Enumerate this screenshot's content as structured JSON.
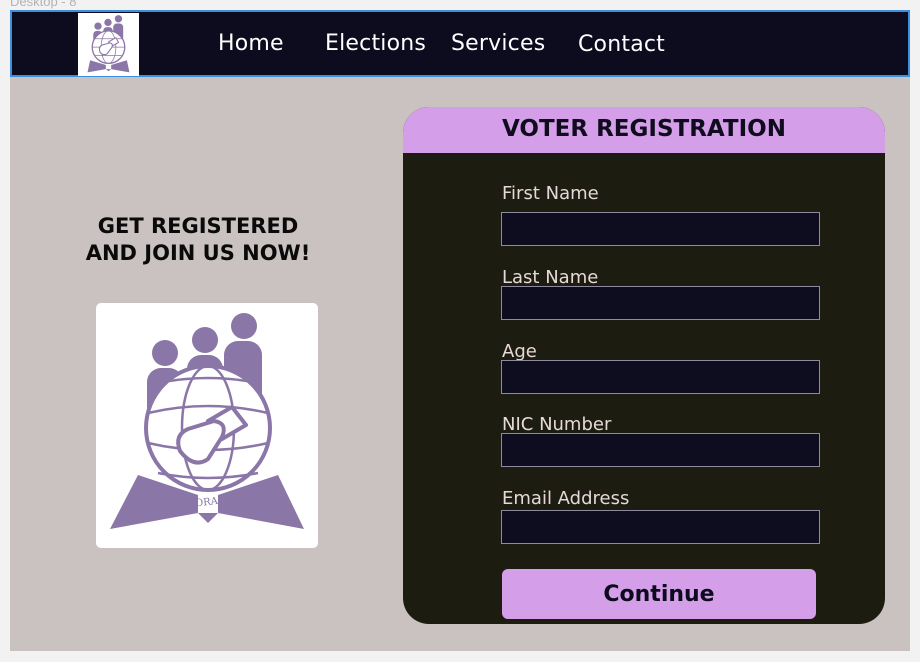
{
  "frame": {
    "label": "Desktop - 8"
  },
  "nav": {
    "logo_alt": "Electoral Poll logo",
    "links": [
      {
        "label": "Home"
      },
      {
        "label": "Elections"
      },
      {
        "label": "Services"
      },
      {
        "label": "Contact"
      }
    ]
  },
  "hero": {
    "line1": "GET REGISTERED",
    "line2": "AND JOIN US NOW!",
    "emblem_text": "ELECTORAL POLL"
  },
  "form": {
    "title": "VOTER REGISTRATION",
    "fields": [
      {
        "label": "First Name",
        "value": ""
      },
      {
        "label": "Last Name",
        "value": ""
      },
      {
        "label": "Age",
        "value": ""
      },
      {
        "label": "NIC Number",
        "value": ""
      },
      {
        "label": "Email Address",
        "value": ""
      }
    ],
    "submit_label": "Continue"
  },
  "colors": {
    "nav_bg": "#0d0c1e",
    "page_bg": "#cac1c1",
    "form_bg": "#1c1d10",
    "accent": "#d49ee8",
    "emblem": "#8b76a8",
    "selection_outline": "#3b8fe0"
  }
}
